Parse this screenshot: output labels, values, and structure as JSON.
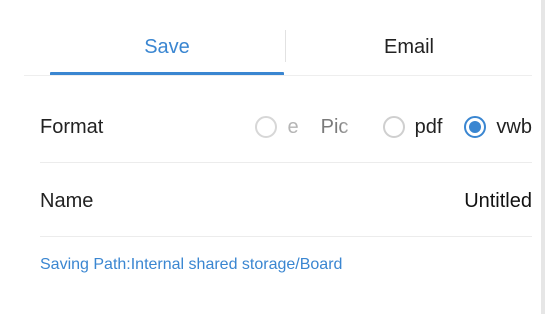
{
  "tabs": [
    {
      "label": "Save",
      "active": true
    },
    {
      "label": "Email",
      "active": false
    }
  ],
  "format": {
    "label": "Format",
    "options": [
      {
        "label": "e",
        "selected": false,
        "disabled": true
      },
      {
        "label": "Pic",
        "selected": false,
        "disabled": true
      },
      {
        "label": "pdf",
        "selected": false,
        "disabled": false
      },
      {
        "label": "vwb",
        "selected": true,
        "disabled": false
      }
    ],
    "selected": "vwb"
  },
  "name": {
    "label": "Name",
    "value": "Untitled"
  },
  "saving_path": "Saving Path:Internal shared storage/Board",
  "colors": {
    "accent": "#3a86d1",
    "text": "#222222",
    "divider": "#ececec",
    "disabled": "#b5b5b5"
  }
}
